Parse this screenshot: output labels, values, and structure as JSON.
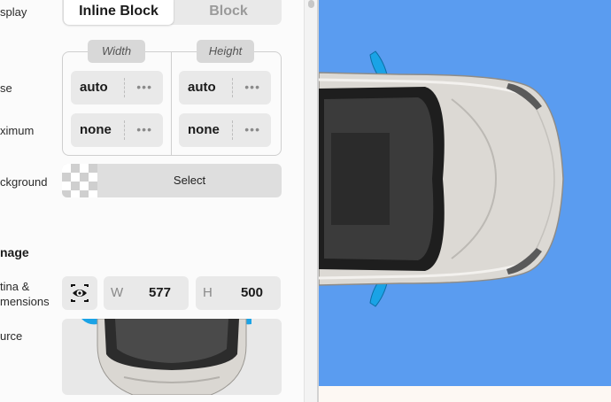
{
  "panel": {
    "labels": {
      "display": "splay",
      "use": "se",
      "maximum": "ximum",
      "background": "ckground",
      "retina_line1": "tina &",
      "retina_line2": "mensions",
      "source": "urce"
    },
    "display_toggle": {
      "active": "Inline Block",
      "inactive": "Block"
    },
    "size": {
      "width_header": "Width",
      "height_header": "Height",
      "width_use": "auto",
      "height_use": "auto",
      "width_max": "none",
      "height_max": "none",
      "more_glyph": "•••"
    },
    "background": {
      "button": "Select"
    },
    "image_section": {
      "title": "nage",
      "width_key": "W",
      "width_value": "577",
      "height_key": "H",
      "height_value": "500"
    }
  },
  "preview": {
    "background_color": "#5a9cf0",
    "footer_color": "#fdf8f3"
  },
  "icons": [
    "eye-icon",
    "more-dots-icon",
    "checkerboard-swatch-icon"
  ]
}
